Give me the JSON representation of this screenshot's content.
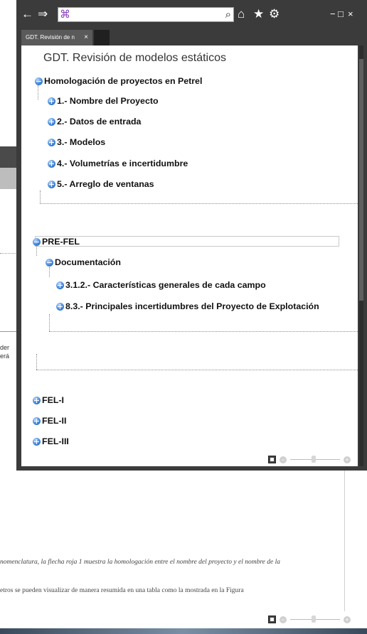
{
  "background": {
    "fragments": [
      "der",
      "erá"
    ],
    "text_lines": [
      "nomenclatura, la flecha roja 1 muestra la homologación entre el nombre del proyecto y el nombre de la",
      "etros se pueden visualizar de manera resumida en una tabla como la mostrada en la  Figura"
    ],
    "zoom_minus": "−",
    "zoom_plus": "+"
  },
  "window": {
    "icons": {
      "back": "arrow-left-icon",
      "forward": "arrow-right-icon",
      "site": "app-logo-icon",
      "search": "search-icon",
      "home": "home-icon",
      "favorite": "star-icon",
      "settings": "gear-icon"
    },
    "address_value": "",
    "controls": {
      "minimize": "−",
      "maximize": "□",
      "close": "×"
    },
    "tab": {
      "label": "GDT. Revisión de n",
      "close": "×"
    },
    "zoom_minus": "−",
    "zoom_plus": "+"
  },
  "document": {
    "title": "GDT. Revisión de modelos estáticos",
    "tree": {
      "homologacion": {
        "label": "Homologación de proyectos en Petrel",
        "children": [
          "1.- Nombre del Proyecto",
          "2.- Datos de entrada",
          "3.- Modelos",
          "4.- Volumetrías e incertidumbre",
          "5.- Arreglo de ventanas"
        ]
      },
      "prefel": {
        "label": "PRE-FEL",
        "documentacion": {
          "label": "Documentación",
          "children": [
            "3.1.2.- Características generales de cada campo",
            "8.3.- Principales incertidumbres del Proyecto de Explotación"
          ]
        }
      },
      "fel1": "FEL-I",
      "fel2": "FEL-II",
      "fel3": "FEL-III"
    }
  }
}
